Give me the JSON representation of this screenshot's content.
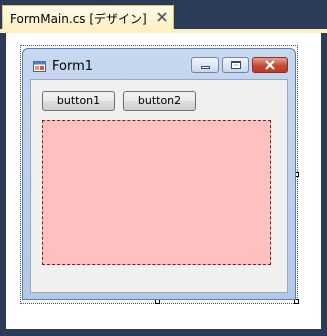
{
  "document_tab": {
    "label": "FormMain.cs [デザイン]",
    "close_icon": "close-icon"
  },
  "form": {
    "title": "Form1",
    "icon": "form-icon",
    "caption_buttons": {
      "minimize_icon": "minimize-icon",
      "maximize_icon": "maximize-icon",
      "close_icon": "close-icon"
    },
    "buttons": [
      {
        "label": "button1"
      },
      {
        "label": "button2"
      }
    ],
    "panel_color": "#ffc0c0",
    "panel_border_color": "#8b1a1a"
  },
  "colors": {
    "ide_background": "#2b3c59",
    "tab_highlight": "#fff0c3",
    "close_button": "#c64a33"
  }
}
